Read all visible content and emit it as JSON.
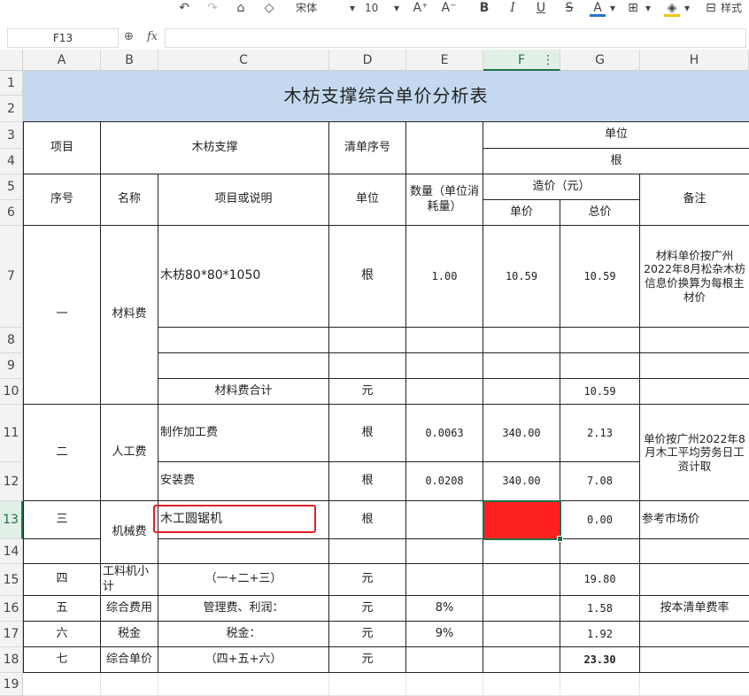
{
  "toolbar": {
    "font_name": "宋体",
    "font_size": "10",
    "style_label": "样式",
    "colors": {
      "font_color_underline": "#2b6fd6",
      "fill_color_underline": "#f5c400"
    }
  },
  "formula_bar": {
    "cell_ref": "F13",
    "fx": "fx",
    "value": ""
  },
  "columns": [
    "A",
    "B",
    "C",
    "D",
    "E",
    "F",
    "G",
    "H"
  ],
  "rows": [
    "1",
    "2",
    "3",
    "4",
    "5",
    "6",
    "7",
    "8",
    "9",
    "10",
    "11",
    "12",
    "13",
    "14",
    "15",
    "16",
    "17",
    "18",
    "19"
  ],
  "sheet": {
    "title": "木枋支撑综合单价分析表",
    "header": {
      "item": "项目",
      "item_value": "木枋支撑",
      "list_no": "清单序号",
      "unit_top": "单位",
      "unit_value": "根",
      "seq": "序号",
      "name": "名称",
      "desc": "项目或说明",
      "unit": "单位",
      "qty": "数量（单位消耗量）",
      "cost": "造价（元）",
      "unit_price": "单价",
      "total": "总价",
      "remark": "备注"
    },
    "material": {
      "seq": "一",
      "name": "材料费",
      "desc": "木枋80*80*1050",
      "unit": "根",
      "qty": "1.00",
      "price": "10.59",
      "total": "10.59",
      "remark": "材料单价按广州2022年8月松杂木枋信息价换算为每根主材价",
      "subtotal_label": "材料费合计",
      "subtotal_unit": "元",
      "subtotal_total": "10.59"
    },
    "labor": {
      "seq": "二",
      "name": "人工费",
      "row1": {
        "desc": "制作加工费",
        "unit": "根",
        "qty": "0.0063",
        "price": "340.00",
        "total": "2.13"
      },
      "row2": {
        "desc": "安装费",
        "unit": "根",
        "qty": "0.0208",
        "price": "340.00",
        "total": "7.08"
      },
      "remark": "单价按广州2022年8月木工平均劳务日工资计取"
    },
    "machine": {
      "seq": "三",
      "name": "机械费",
      "desc": "木工圆锯机",
      "unit": "根",
      "total": "0.00",
      "remark": "参考市场价"
    },
    "subtotal": {
      "seq": "四",
      "name": "工料机小计",
      "desc": "（一+二+三）",
      "unit": "元",
      "total": "19.80"
    },
    "overhead": {
      "seq": "五",
      "name": "综合费用",
      "desc": "管理费、利润：",
      "unit": "元",
      "rate": "8%",
      "total": "1.58",
      "remark": "按本清单费率"
    },
    "tax": {
      "seq": "六",
      "name": "税金",
      "desc": "税金：",
      "unit": "元",
      "rate": "9%",
      "total": "1.92"
    },
    "composite": {
      "seq": "七",
      "name": "综合单价",
      "desc": "（四+五+六）",
      "unit": "元",
      "total": "23.30"
    }
  },
  "highlight_colors": {
    "selected_fill": "#ff2020",
    "annotation_border": "#e0202a",
    "title_fill": "#c4d9ef"
  }
}
